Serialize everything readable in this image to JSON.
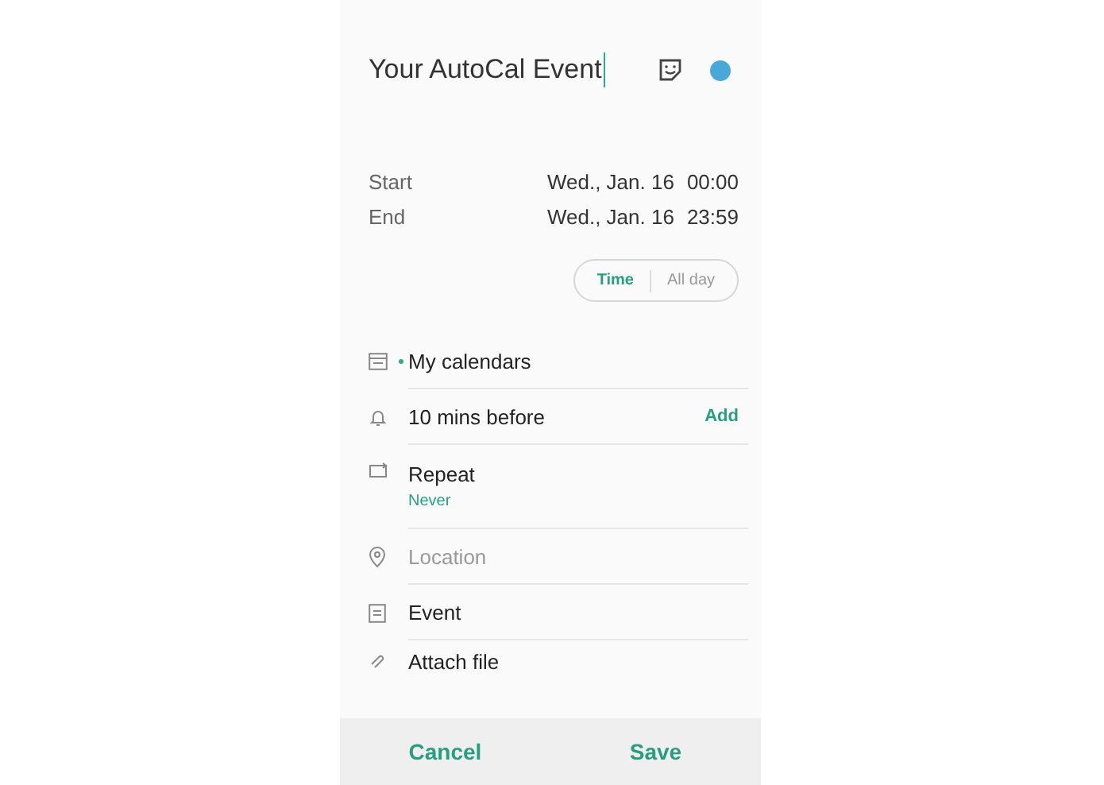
{
  "title": {
    "value": "Your AutoCal Event",
    "color": "#4aa8d8"
  },
  "times": [
    {
      "label": "Start",
      "date": "Wed., Jan. 16",
      "time": "00:00"
    },
    {
      "label": "End",
      "date": "Wed., Jan. 16",
      "time": "23:59"
    }
  ],
  "mode_toggle": [
    {
      "label": "Time",
      "selected": true
    },
    {
      "label": "All day",
      "selected": false
    }
  ],
  "rows": [
    {
      "kind": "calendar",
      "text": "My calendars",
      "color": "#2bab8c"
    },
    {
      "kind": "reminder",
      "text": "10 mins before",
      "action": "Add"
    },
    {
      "kind": "repeat",
      "text": "Repeat",
      "subtext": "Never"
    },
    {
      "kind": "location",
      "placeholder": "Location"
    },
    {
      "kind": "notes",
      "text": "Event"
    },
    {
      "kind": "attach",
      "text": "Attach file"
    }
  ],
  "buttons": [
    "Cancel",
    "Save"
  ]
}
